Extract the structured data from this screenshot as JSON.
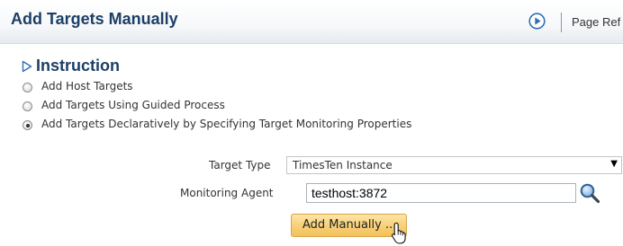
{
  "header": {
    "title": "Add Targets Manually",
    "page_refresh_label": "Page Ref",
    "help_icon": "play-circle-icon"
  },
  "instruction": {
    "title": "Instruction",
    "disclosure_icon": "disclosure-triangle-icon",
    "options": [
      {
        "label": "Add Host Targets",
        "selected": false
      },
      {
        "label": "Add Targets Using Guided Process",
        "selected": false
      },
      {
        "label": "Add Targets Declaratively by Specifying Target Monitoring Properties",
        "selected": true
      }
    ]
  },
  "form": {
    "target_type_label": "Target Type",
    "target_type_value": "TimesTen Instance",
    "monitoring_agent_label": "Monitoring Agent",
    "monitoring_agent_value": "testhost:3872",
    "search_icon": "magnifier-icon",
    "add_button_label": "Add Manually ..."
  },
  "colors": {
    "title": "#1d3f66",
    "button_fill": "#f8d17a",
    "button_border": "#d9a44a",
    "accent_blue": "#2e6fb5"
  }
}
